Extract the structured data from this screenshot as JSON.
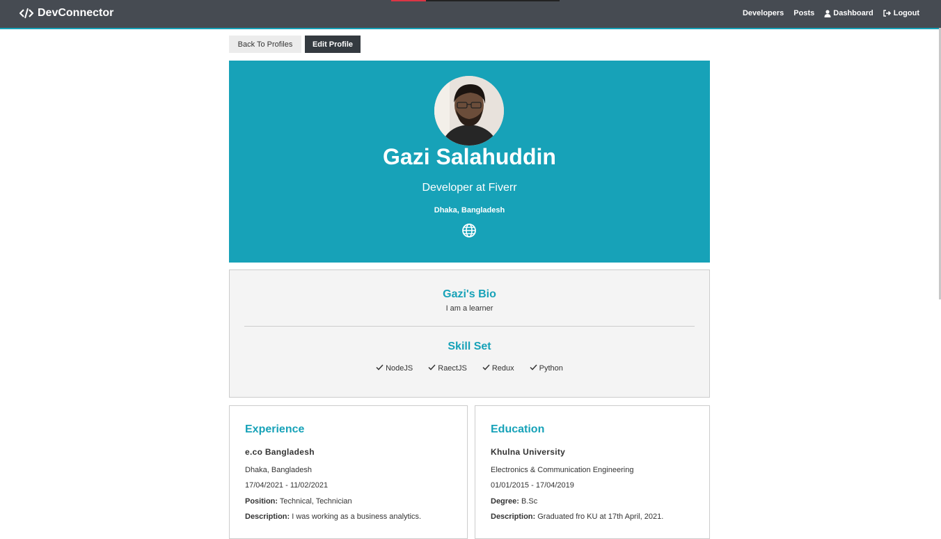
{
  "nav": {
    "brand": "DevConnector",
    "links": [
      {
        "label": "Developers"
      },
      {
        "label": "Posts"
      },
      {
        "label": "Dashboard",
        "icon": "user-icon"
      },
      {
        "label": "Logout",
        "icon": "sign-out-icon"
      }
    ]
  },
  "actions": {
    "back_label": "Back To Profiles",
    "edit_label": "Edit Profile"
  },
  "profile": {
    "name": "Gazi Salahuddin",
    "status": "Developer at Fiverr",
    "location": "Dhaka, Bangladesh",
    "website_icon": "globe-icon"
  },
  "about": {
    "bio_title": "Gazi's Bio",
    "bio": "I am a learner",
    "skills_title": "Skill Set",
    "skills": [
      "NodeJS",
      "RaectJS",
      "Redux",
      "Python"
    ]
  },
  "experience": {
    "title": "Experience",
    "company": "e.co Bangladesh",
    "location": "Dhaka, Bangladesh",
    "dates": "17/04/2021 - 11/02/2021",
    "position_label": "Position:",
    "position": "Technical, Technician",
    "description_label": "Description:",
    "description": "I was working as a business analytics."
  },
  "education": {
    "title": "Education",
    "school": "Khulna University",
    "field": "Electronics & Communication Engineering",
    "dates": "01/01/2015 - 17/04/2019",
    "degree_label": "Degree:",
    "degree": "B.Sc",
    "description_label": "Description:",
    "description": "Graduated fro KU at 17th April, 2021."
  },
  "colors": {
    "primary": "#17a2b8",
    "navbar": "#464b52",
    "dark": "#343a40",
    "light": "#f4f4f4"
  }
}
